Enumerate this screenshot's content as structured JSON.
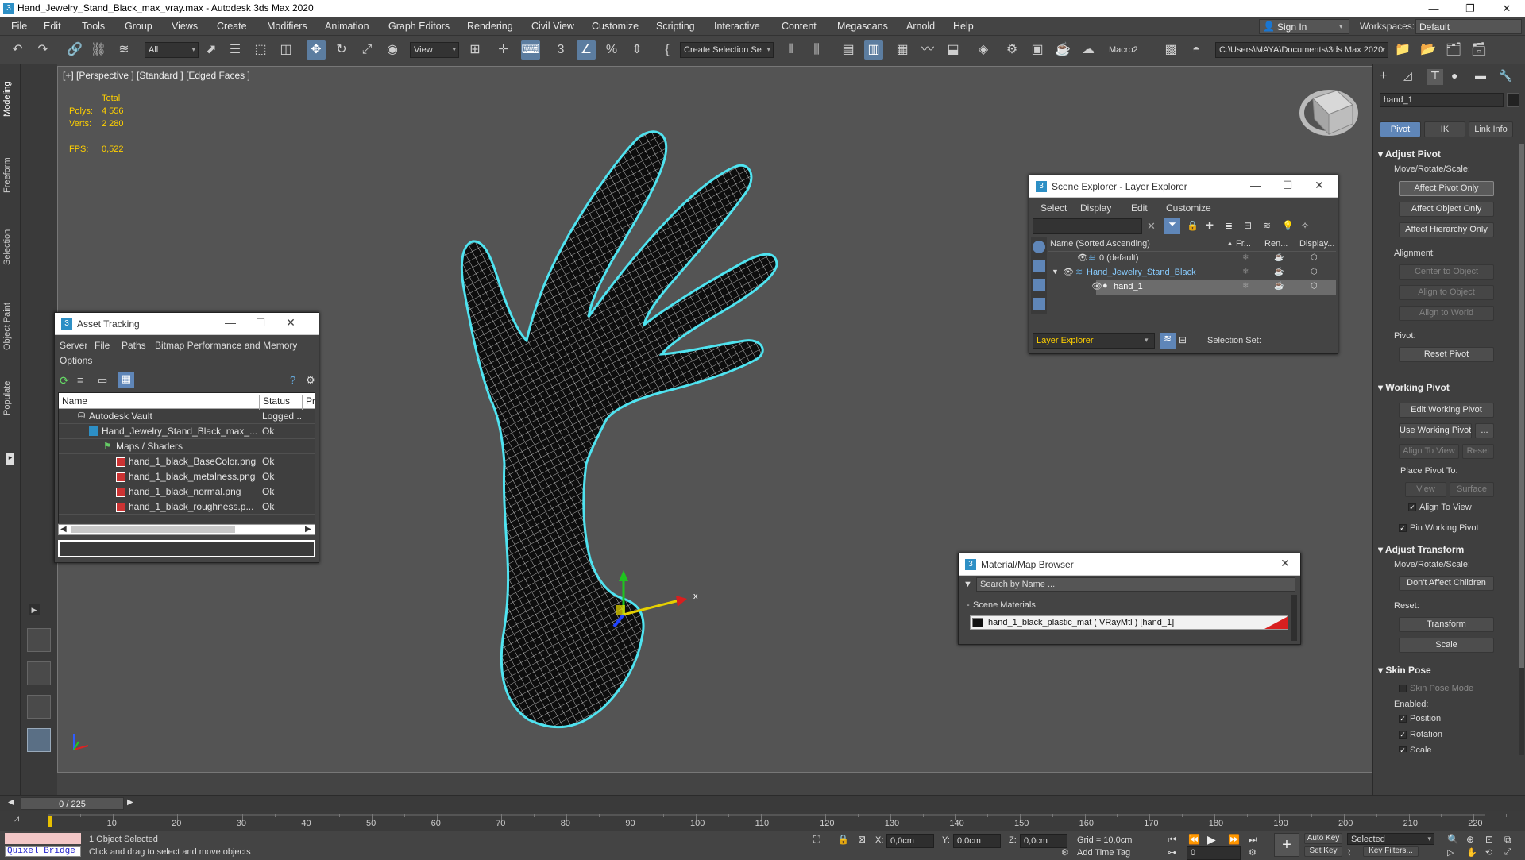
{
  "window": {
    "title": "Hand_Jewelry_Stand_Black_max_vray.max - Autodesk 3ds Max 2020",
    "controls": {
      "minimize": "—",
      "restore": "❐",
      "close": "✕"
    }
  },
  "menu": {
    "items": [
      "File",
      "Edit",
      "Tools",
      "Group",
      "Views",
      "Create",
      "Modifiers",
      "Animation",
      "Graph Editors",
      "Rendering",
      "Civil View",
      "Customize",
      "Scripting",
      "Interactive",
      "Content",
      "Megascans",
      "Arnold",
      "Help"
    ],
    "sign_in": "Sign In",
    "workspaces_label": "Workspaces:",
    "workspace_value": "Default"
  },
  "toolbar": {
    "filter_value": "All",
    "ref_coord_value": "View",
    "selection_set_value": "Create Selection Se",
    "macro_label": "Macro2",
    "project_path": "C:\\Users\\MAYA\\Documents\\3ds Max 2020"
  },
  "left_tabs": [
    "Modeling",
    "Freeform",
    "Selection",
    "Object Paint",
    "Populate"
  ],
  "viewport": {
    "label": "[+] [Perspective ] [Standard ] [Edged Faces ]",
    "stats": {
      "total_label": "Total",
      "polys_label": "Polys:",
      "polys_value": "4 556",
      "verts_label": "Verts:",
      "verts_value": "2 280",
      "fps_label": "FPS:",
      "fps_value": "0,522"
    },
    "gizmo_x_label": "x"
  },
  "asset_tracking": {
    "title": "Asset Tracking",
    "menu": [
      "Server",
      "File",
      "Paths",
      "Bitmap Performance and Memory",
      "Options"
    ],
    "columns": [
      "Name",
      "Status",
      "Pr"
    ],
    "rows": [
      {
        "name": "Autodesk Vault",
        "status": "Logged ..."
      },
      {
        "name": "Hand_Jewelry_Stand_Black_max_...",
        "status": "Ok"
      },
      {
        "name": "Maps / Shaders",
        "status": ""
      },
      {
        "name": "hand_1_black_BaseColor.png",
        "status": "Ok"
      },
      {
        "name": "hand_1_black_metalness.png",
        "status": "Ok"
      },
      {
        "name": "hand_1_black_normal.png",
        "status": "Ok"
      },
      {
        "name": "hand_1_black_roughness.p...",
        "status": "Ok"
      }
    ]
  },
  "scene_explorer": {
    "title": "Scene Explorer - Layer Explorer",
    "menu": [
      "Select",
      "Display",
      "Edit",
      "Customize"
    ],
    "columns": [
      "Name (Sorted Ascending)",
      "Fr...",
      "Ren...",
      "Display..."
    ],
    "rows": [
      {
        "name": "0 (default)"
      },
      {
        "name": "Hand_Jewelry_Stand_Black"
      },
      {
        "name": "hand_1"
      }
    ],
    "explorer_value": "Layer Explorer",
    "selection_set_label": "Selection Set:"
  },
  "material_browser": {
    "title": "Material/Map Browser",
    "search_placeholder": "Search by Name ...",
    "section": "Scene Materials",
    "material": "hand_1_black_plastic_mat ( VRayMtl ) [hand_1]"
  },
  "command_panel": {
    "object_name": "hand_1",
    "tabs": [
      "Pivot",
      "IK",
      "Link Info"
    ],
    "adjust_pivot": {
      "title": "Adjust Pivot",
      "move_label": "Move/Rotate/Scale:",
      "affect_pivot_only": "Affect Pivot Only",
      "affect_object_only": "Affect Object Only",
      "affect_hierarchy_only": "Affect Hierarchy Only",
      "alignment_label": "Alignment:",
      "center_to_object": "Center to Object",
      "align_to_object": "Align to Object",
      "align_to_world": "Align to World",
      "pivot_label": "Pivot:",
      "reset_pivot": "Reset Pivot"
    },
    "working_pivot": {
      "title": "Working Pivot",
      "edit_working_pivot": "Edit Working Pivot",
      "use_working_pivot": "Use Working Pivot",
      "dots": "...",
      "align_to_view": "Align To View",
      "reset": "Reset",
      "place_pivot_label": "Place Pivot To:",
      "view": "View",
      "surface": "Surface",
      "align_to_view_check": "Align To View",
      "pin_working_pivot": "Pin Working Pivot"
    },
    "adjust_transform": {
      "title": "Adjust Transform",
      "move_label": "Move/Rotate/Scale:",
      "dont_affect_children": "Don't Affect Children",
      "reset_label": "Reset:",
      "transform": "Transform",
      "scale": "Scale"
    },
    "skin_pose": {
      "title": "Skin Pose",
      "skin_pose_mode": "Skin Pose Mode",
      "enabled_label": "Enabled:",
      "position": "Position",
      "rotation": "Rotation",
      "scale": "Scale"
    }
  },
  "timeline": {
    "frame_display": "0 / 225",
    "ticks": [
      "10",
      "20",
      "30",
      "40",
      "50",
      "60",
      "70",
      "80",
      "90",
      "100",
      "110",
      "120",
      "130",
      "140",
      "150",
      "160",
      "170",
      "180",
      "190",
      "200",
      "210",
      "220"
    ]
  },
  "status": {
    "quixel": "Quixel Bridge",
    "selected": "1 Object Selected",
    "hint": "Click and drag to select and move objects",
    "x_label": "X:",
    "x_value": "0,0cm",
    "y_label": "Y:",
    "y_value": "0,0cm",
    "z_label": "Z:",
    "z_value": "0,0cm",
    "grid": "Grid = 10,0cm",
    "add_time_tag": "Add Time Tag",
    "auto_key": "Auto Key",
    "set_key": "Set Key",
    "key_mode_value": "Selected",
    "frame_value": "0",
    "key_filters": "Key Filters..."
  },
  "colors": {
    "selection_outline": "#4fe3f0",
    "mesh_fill": "#111111",
    "accent": "#5f86b8"
  }
}
